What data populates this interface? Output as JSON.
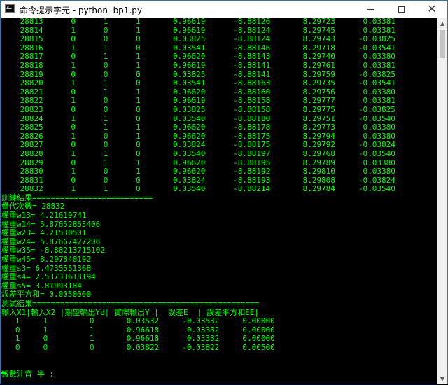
{
  "window": {
    "title": "命令提示字元 - python  bp1.py",
    "minimize_label": "minimize",
    "maximize_label": "maximize",
    "close_label": "close"
  },
  "console": {
    "lines": [
      "    28813      0      1      1       0.96619      -8.88126       8.29723      0.03381",
      "    28814      1      0      1       0.96619      -8.88124       8.29745      0.03381",
      "    28815      0      0      0       0.03825      -8.88124       8.29743     -0.03825",
      "    28816      1      1      0       0.03541      -8.88146       8.29718     -0.03541",
      "    28817      0      1      1       0.96620      -8.88143       8.29740      0.03380",
      "    28818      1      0      1       0.96619      -8.88141       8.29761      0.03381",
      "    28819      0      0      0       0.03825      -8.88141       8.29759     -0.03825",
      "    28820      1      1      0       0.03541      -8.88163       8.29735     -0.03541",
      "    28821      0      1      1       0.96620      -8.88160       8.29756      0.03380",
      "    28822      1      0      1       0.96619      -8.88158       8.29777      0.03381",
      "    28823      0      0      0       0.03825      -8.88158       8.29775     -0.03825",
      "    28824      1      1      0       0.03540      -8.88180       8.29751     -0.03540",
      "    28825      0      1      1       0.96620      -8.88178       8.29773      0.03380",
      "    28826      1      0      1       0.96620      -8.88175       8.29794      0.03380",
      "    28827      0      0      0       0.03824      -8.88175       8.29792     -0.03824",
      "    28828      1      1      0       0.03540      -8.88197       8.29768     -0.03540",
      "    28829      0      1      1       0.96620      -8.88195       8.29789      0.03380",
      "    28830      1      0      1       0.96620      -8.88192       8.29810      0.03380",
      "    28831      0      0      0       0.03824      -8.88193       8.29808     -0.03824",
      "    28832      1      1      0       0.03540      -8.88214       8.29784     -0.03540",
      "訓練結果==========================",
      "疊代次數= 28832",
      "權重w13= 4.21619741",
      "權重w14= 5.87652863406",
      "權重w23= 4.21530501",
      "權重w24= 5.87667427206",
      "權重w35= -8.88213715102",
      "權重w45= 8.297840192",
      "權重s3= 6.4735551368",
      "權重s4= 2.53733618194",
      "權重s5= 3.81993184",
      "誤差平方和= 0.0050000",
      "測試結果=================================================",
      "輸入X1|輸入X2 |期望輸出Yd| 實際輸出Y |  誤差E  | 誤差平方和EE|",
      "   1     1         0       0.03532     -0.03532     0.00000",
      "   0     1         1       0.96618      0.03382     0.00000",
      "   1     0         1       0.96618      0.03382     0.00000",
      "   0     0         0       0.03822     -0.03822     0.00500",
      "",
      "",
      "微數注音 半 :"
    ]
  },
  "colors": {
    "console_text": "#00ff00",
    "console_bg": "#000000",
    "titlebar_bg": "#ffffff"
  },
  "icons": {
    "app": "console-app-icon",
    "minimize": "minimize-icon",
    "maximize": "maximize-icon",
    "close": "close-icon"
  }
}
